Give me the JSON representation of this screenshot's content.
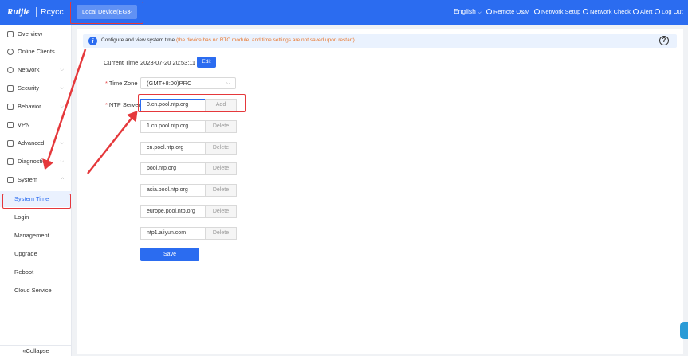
{
  "header": {
    "logo_text": "Ruijie",
    "brand_text": "Rcycc",
    "device_select": "Local Device(EG3",
    "language": "English",
    "items": [
      {
        "label": "Remote O&M",
        "icon": "cloud-icon"
      },
      {
        "label": "Network Setup",
        "icon": "network-icon"
      },
      {
        "label": "Network Check",
        "icon": "check-icon"
      },
      {
        "label": "Alert",
        "icon": "bell-icon"
      },
      {
        "label": "Log Out",
        "icon": "logout-icon"
      }
    ]
  },
  "sidebar": {
    "items": [
      {
        "label": "Overview",
        "icon": "overview-icon"
      },
      {
        "label": "Online Clients",
        "icon": "clients-icon"
      },
      {
        "label": "Network",
        "icon": "globe-icon",
        "expandable": true
      },
      {
        "label": "Security",
        "icon": "shield-icon",
        "expandable": true
      },
      {
        "label": "Behavior",
        "icon": "behavior-icon",
        "expandable": true
      },
      {
        "label": "VPN",
        "icon": "vpn-icon"
      },
      {
        "label": "Advanced",
        "icon": "advanced-icon",
        "expandable": true
      },
      {
        "label": "Diagnostics",
        "icon": "diagnostics-icon",
        "expandable": true
      },
      {
        "label": "System",
        "icon": "system-icon",
        "expandable": true,
        "expanded": true
      }
    ],
    "sub_items": [
      {
        "label": "System Time",
        "active": true
      },
      {
        "label": "Login"
      },
      {
        "label": "Management"
      },
      {
        "label": "Upgrade"
      },
      {
        "label": "Reboot"
      },
      {
        "label": "Cloud Service"
      }
    ],
    "collapse_label": "Collapse"
  },
  "main": {
    "info": {
      "text": "Configure and view system time",
      "note": "(the device has no RTC module, and time settings are not saved upon restart)."
    },
    "current_time_label": "Current Time",
    "current_time_value": "2023-07-20 20:53:11",
    "edit_label": "Edit",
    "time_zone_label": "Time Zone",
    "time_zone_value": "(GMT+8:00)PRC",
    "ntp_label": "NTP Server",
    "ntp_servers": [
      {
        "value": "0.cn.pool.ntp.org",
        "action": "Add"
      },
      {
        "value": "1.cn.pool.ntp.org",
        "action": "Delete"
      },
      {
        "value": "cn.pool.ntp.org",
        "action": "Delete"
      },
      {
        "value": "pool.ntp.org",
        "action": "Delete"
      },
      {
        "value": "asia.pool.ntp.org",
        "action": "Delete"
      },
      {
        "value": "europe.pool.ntp.org",
        "action": "Delete"
      },
      {
        "value": "ntp1.aliyun.com",
        "action": "Delete"
      }
    ],
    "save_label": "Save"
  },
  "colors": {
    "accent": "#2b6cf0",
    "annotation": "#e5383b",
    "warning_text": "#e8762d"
  }
}
